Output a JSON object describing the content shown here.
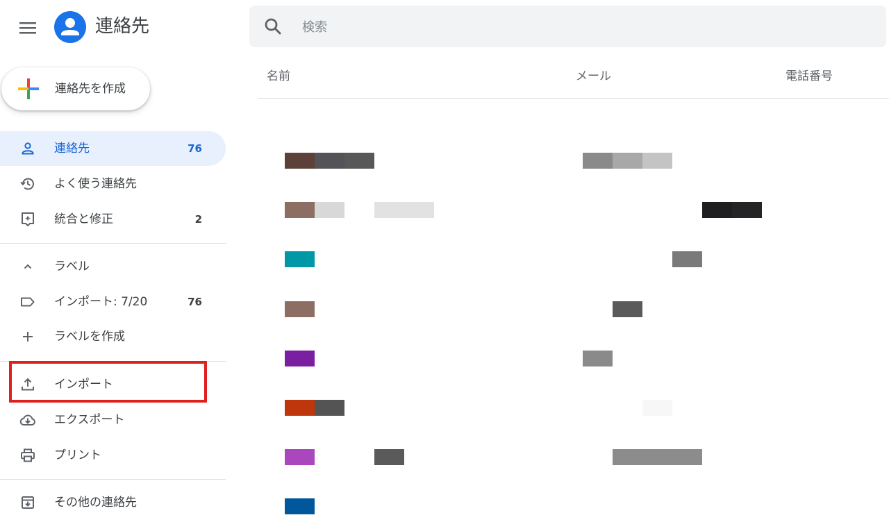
{
  "app": {
    "title": "連絡先",
    "logo_icon": "person-icon",
    "menu_icon": "hamburger-menu-icon"
  },
  "search": {
    "placeholder": "検索",
    "value": "",
    "icon": "search-icon"
  },
  "create_button": {
    "label": "連絡先を作成",
    "icon": "plus-icon"
  },
  "sidebar": {
    "main_items": [
      {
        "icon": "person-icon",
        "label": "連絡先",
        "count": "76",
        "active": true
      },
      {
        "icon": "history-icon",
        "label": "よく使う連絡先",
        "count": ""
      },
      {
        "icon": "merge-fix-icon",
        "label": "統合と修正",
        "count": "2"
      }
    ],
    "labels_section": {
      "toggle_icon": "chevron-up-icon",
      "header": "ラベル",
      "items": [
        {
          "icon": "label-icon",
          "label": "インポート: 7/20",
          "count": "76"
        }
      ],
      "create_label": {
        "icon": "plus-icon",
        "label": "ラベルを作成"
      }
    },
    "tools": [
      {
        "icon": "upload-icon",
        "label": "インポート",
        "highlighted": true
      },
      {
        "icon": "cloud-download-icon",
        "label": "エクスポート"
      },
      {
        "icon": "print-icon",
        "label": "プリント"
      }
    ],
    "other": {
      "icon": "archive-icon",
      "label": "その他の連絡先"
    }
  },
  "table": {
    "columns": [
      "名前",
      "メール",
      "電話番号"
    ],
    "rows": [
      {
        "name_blocks": [
          "#5d4037",
          "#545458",
          "#585858"
        ],
        "email_blocks": [
          "#8a8a8a",
          "#a8a8a8",
          "#c4c4c4"
        ]
      },
      {
        "name_blocks": [
          "#8d6e63",
          "#d8d8d8",
          null,
          "#e2e2e2",
          "#e2e2e2"
        ],
        "email_blocks": [
          null,
          null,
          null,
          null,
          "#1f1f22",
          "#242426"
        ]
      },
      {
        "name_blocks": [
          "#0097a7"
        ],
        "email_blocks": [
          null,
          null,
          null,
          "#7a7a7a"
        ]
      },
      {
        "name_blocks": [
          "#8d6e63"
        ],
        "email_blocks": [
          null,
          "#5a5a5a"
        ]
      },
      {
        "name_blocks": [
          "#7b1fa2"
        ],
        "email_blocks": [
          "#8a8a8a"
        ]
      },
      {
        "name_blocks": [
          "#bf360c",
          "#545454"
        ],
        "email_blocks": [
          null,
          null,
          "#f7f7f7"
        ]
      },
      {
        "name_blocks": [
          "#ab47bc",
          null,
          null,
          "#5a5a5a"
        ],
        "email_blocks": [
          null,
          "#8c8c8c",
          "#8c8c8c",
          "#8c8c8c"
        ]
      },
      {
        "name_blocks": [
          "#01579b"
        ],
        "email_blocks": []
      }
    ]
  },
  "colors": {
    "accent": "#1a73e8",
    "active_bg": "#e8f0fe",
    "active_text": "#1967d2",
    "highlight_border": "#e0201f"
  }
}
